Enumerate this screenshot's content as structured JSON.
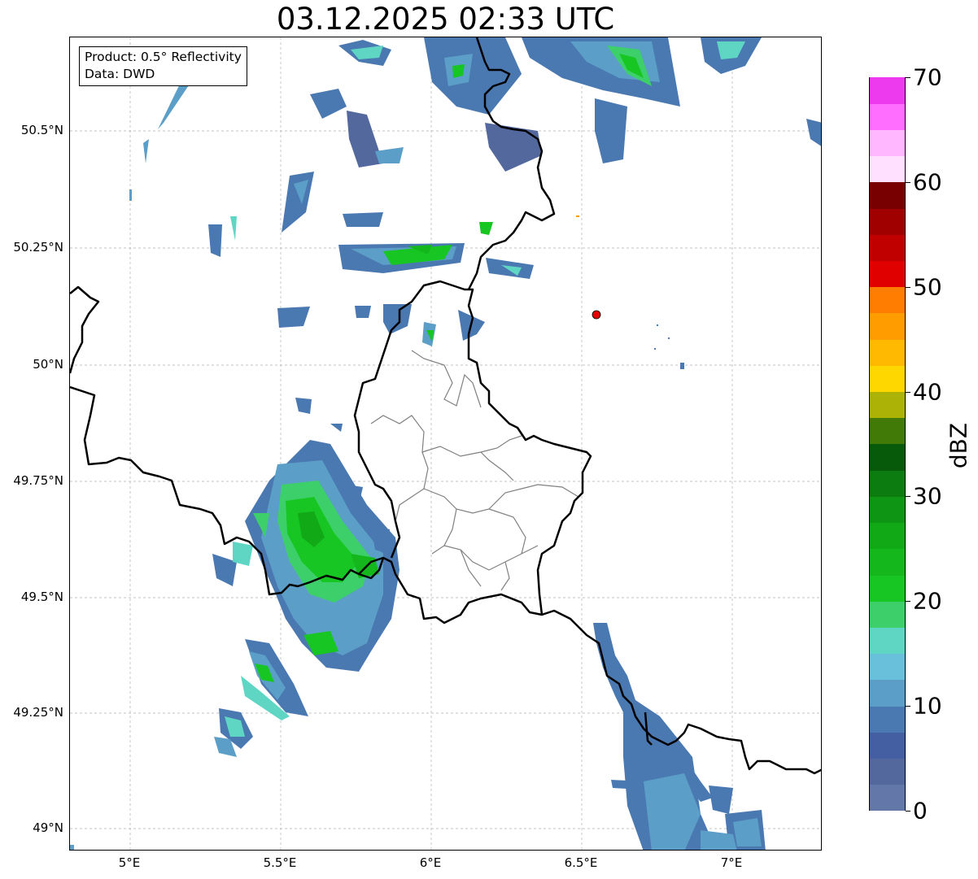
{
  "title": "03.12.2025 02:33 UTC",
  "info": {
    "product": "Product: 0.5° Reflectivity",
    "data_source": "Data: DWD"
  },
  "map": {
    "lon_range": [
      4.8,
      7.3
    ],
    "lat_range": [
      48.95,
      50.7
    ],
    "lat_ticks": [
      "50.5°N",
      "50.25°N",
      "50°N",
      "49.75°N",
      "49.5°N",
      "49.25°N",
      "49°N"
    ],
    "lon_ticks": [
      "5°E",
      "5.5°E",
      "6°E",
      "6.5°E",
      "7°E"
    ],
    "grid": "dashed",
    "radar_site": {
      "lon": 6.55,
      "lat": 50.11,
      "color": "#e00000"
    }
  },
  "colorbar": {
    "label": "dBZ",
    "ticks": [
      "0",
      "10",
      "20",
      "30",
      "40",
      "50",
      "60",
      "70"
    ],
    "range": [
      0,
      70
    ],
    "colors": [
      "#6377a8",
      "#53699e",
      "#4460a3",
      "#4a78b0",
      "#5b9ec8",
      "#69c0db",
      "#5fd6c4",
      "#3dd06a",
      "#18c623",
      "#14b81c",
      "#12a917",
      "#0f9514",
      "#0c7b10",
      "#075a0a",
      "#427a07",
      "#adb207",
      "#ffd700",
      "#ffba00",
      "#ff9c00",
      "#ff7d00",
      "#e00000",
      "#c00000",
      "#a00000",
      "#780000",
      "#ffe0ff",
      "#ffb8ff",
      "#ff6eff",
      "#ee3aee"
    ]
  },
  "colors": {
    "border_country": "#000000",
    "border_canton": "#808080",
    "grid": "#b0b0b0"
  }
}
